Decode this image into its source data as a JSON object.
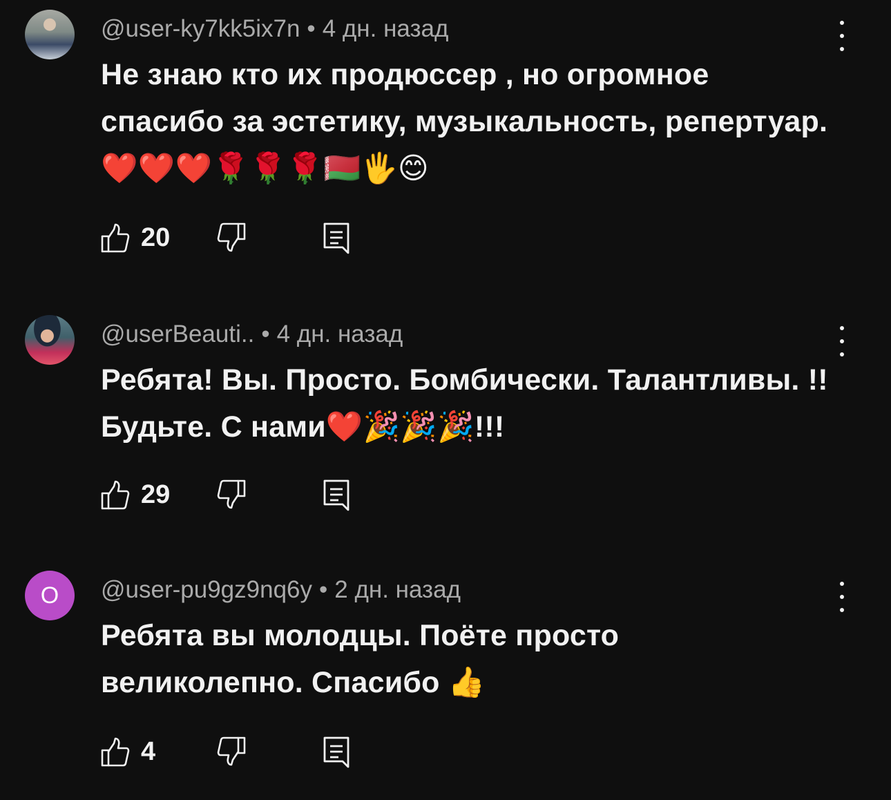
{
  "comments": [
    {
      "author": "@user-ky7kk5ix7n",
      "time": "4 дн. назад",
      "text": "Не знаю кто их продюссер , но огромное спасибо за эстетику, музыкальность, репертуар. ❤️❤️❤️🌹🌹🌹🇧🇾🖐️😊",
      "likes": "20",
      "avatar_kind": "photo"
    },
    {
      "author": "@userBeauti..",
      "time": "4 дн. назад",
      "text": "Ребята! Вы. Просто. Бомбически. Талантливы. !!  Будьте. С нами❤️🎉🎉🎉!!!",
      "likes": "29",
      "avatar_kind": "photo"
    },
    {
      "author": "@user-pu9gz9nq6y",
      "time": "2 дн. назад",
      "text": "Ребята  вы молодцы. Поёте просто великолепно. Спасибо 👍",
      "likes": "4",
      "avatar_letter": "О",
      "avatar_color": "#b94cc8"
    }
  ],
  "separator": "•",
  "icons": {
    "like": "thumb-up-icon",
    "dislike": "thumb-down-icon",
    "reply": "reply-icon",
    "menu": "more-vert-icon"
  }
}
